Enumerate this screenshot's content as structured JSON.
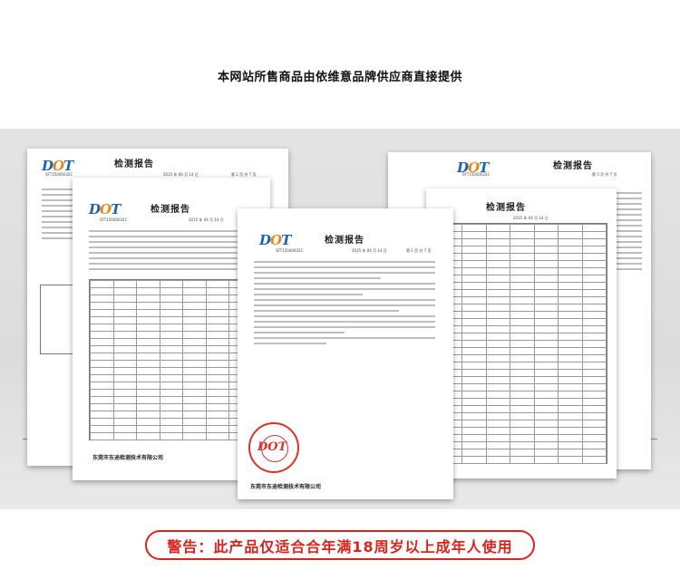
{
  "header_note": "本网站所售商品由依维意品牌供应商直接提供",
  "report": {
    "logo": "DOT",
    "title": "检测报告",
    "report_no": "SFT15040032C",
    "date_line": "2015 年 04 月 14 日",
    "page_center": "第 1 页  共 7 页",
    "page_left": "第 2 页  共 7 页",
    "page_right": "第 3 页  共 7 页",
    "org_name": "东莞市东迪检测技术有限公司"
  },
  "warning": "警告：此产品仅适合合年满18周岁以上成年人使用",
  "colors": {
    "logo_blue": "#1a62b3",
    "logo_orange": "#e48a14",
    "stamp_red": "#d8322a",
    "warning_red": "#d9231b"
  }
}
